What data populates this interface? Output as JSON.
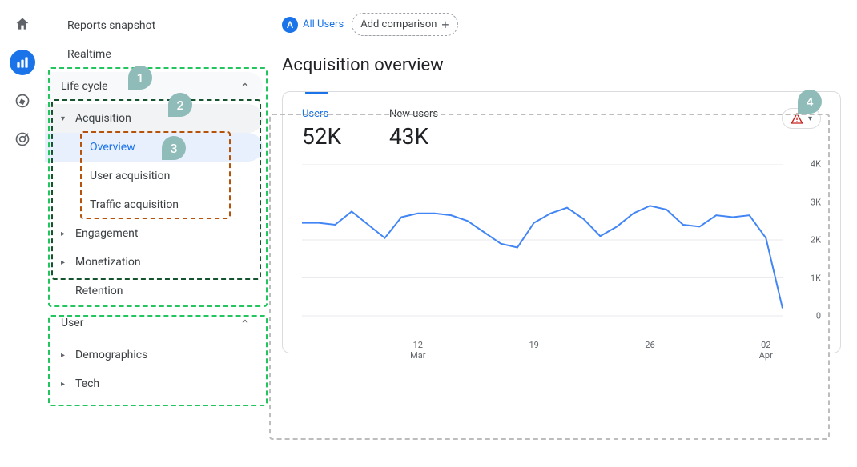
{
  "iconbar": {
    "home": "home-icon",
    "reports": "chart-icon",
    "explore": "explore-icon",
    "ads": "target-icon"
  },
  "sidebar": {
    "snapshot": "Reports snapshot",
    "realtime": "Realtime",
    "lifecycle": {
      "label": "Life cycle",
      "acquisition": {
        "label": "Acquisition",
        "overview": "Overview",
        "user_acq": "User acquisition",
        "traffic_acq": "Traffic acquisition"
      },
      "engagement": "Engagement",
      "monetization": "Monetization",
      "retention": "Retention"
    },
    "user": {
      "label": "User",
      "demographics": "Demographics",
      "tech": "Tech"
    }
  },
  "topbar": {
    "audience_letter": "A",
    "audience_label": "All Users",
    "compare_label": "Add comparison"
  },
  "page_title": "Acquisition overview",
  "metrics": {
    "users_label": "Users",
    "users_value": "52K",
    "newusers_label": "New users",
    "newusers_value": "43K"
  },
  "annotations": {
    "b1": "1",
    "b2": "2",
    "b3": "3",
    "b4": "4"
  },
  "chart_data": {
    "type": "line",
    "title": "",
    "xlabel": "",
    "ylabel": "",
    "ylim": [
      0,
      4000
    ],
    "y_ticks": [
      0,
      1000,
      2000,
      3000,
      4000
    ],
    "y_tick_labels": [
      "0",
      "1K",
      "2K",
      "3K",
      "4K"
    ],
    "x_tick_labels": [
      {
        "top": "12",
        "sub": "Mar"
      },
      {
        "top": "19",
        "sub": ""
      },
      {
        "top": "26",
        "sub": ""
      },
      {
        "top": "02",
        "sub": "Apr"
      }
    ],
    "series": [
      {
        "name": "Users",
        "color": "#4285f4",
        "values": [
          2450,
          2450,
          2400,
          2750,
          2400,
          2050,
          2600,
          2700,
          2700,
          2650,
          2500,
          2200,
          1900,
          1800,
          2450,
          2700,
          2850,
          2550,
          2100,
          2350,
          2700,
          2900,
          2800,
          2400,
          2350,
          2650,
          2600,
          2650,
          2050,
          200
        ]
      }
    ]
  }
}
